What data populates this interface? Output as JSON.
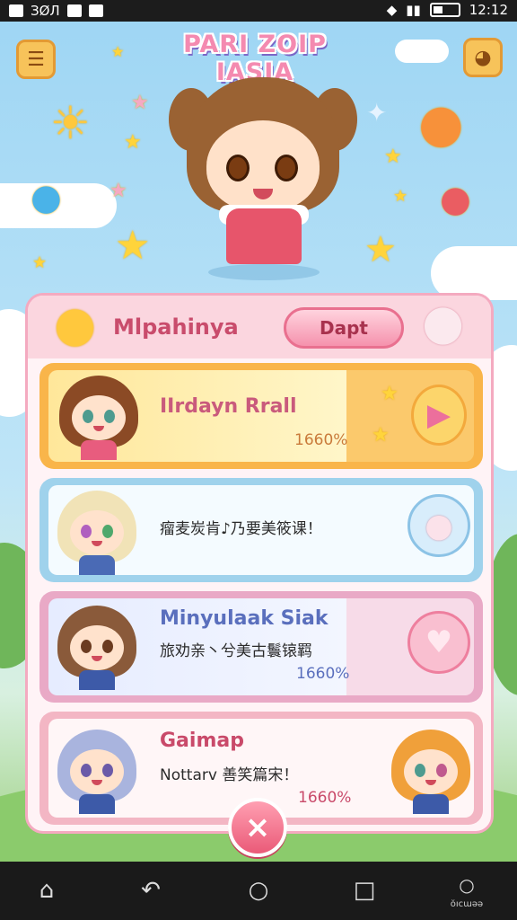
{
  "status_bar": {
    "left_text": "ЗØЛ",
    "time": "12:12",
    "icons": [
      "notification-icon",
      "photo-icon",
      "wifi-icon",
      "signal-icon",
      "battery-icon"
    ]
  },
  "header": {
    "title": "PARI ZOIP IASIA",
    "menu_icon": "menu-icon",
    "shop_icon": "shop-icon"
  },
  "panel": {
    "title": "Mlpahinya",
    "dapt_button": "Dapt"
  },
  "cards": [
    {
      "name": "IIrdayn Rrall",
      "text": "",
      "percent": "1660%",
      "action_icon": "play-icon",
      "avatar_hair": "#8b4a25",
      "accent": "#c95a7c"
    },
    {
      "name": "",
      "text": "瘤麦炭肯♪乃要美筱课！",
      "percent": "",
      "action_icon": "bunny-icon",
      "avatar_hair": "#f1e3b7",
      "accent": "#2b2b2b"
    },
    {
      "name": "Minyulaak Siak",
      "text": "旅劝亲丶兮美古鬟锿羁",
      "percent": "1660%",
      "action_icon": "heart-icon",
      "avatar_hair": "#8a5a3a",
      "accent": "#5a6fbd"
    },
    {
      "name": "Gaimap",
      "text": "Nottarv 善笑篇宋！",
      "percent": "1660%",
      "action_icon": "",
      "avatar_hair": "#a9b4de",
      "accent": "#c94a6a"
    }
  ],
  "close_button": "×",
  "nav": {
    "label": "ŏıcɯəə",
    "icons": [
      "home-icon",
      "back-icon",
      "circle-home-icon",
      "recents-icon",
      "assistant-icon"
    ]
  },
  "colors": {
    "sky": "#a9d8f2",
    "panel_border": "#f4aac0",
    "card1": "#ffe79a",
    "card2": "#eaf7ff",
    "card3": "#e6ecff",
    "card4": "#fff2f3",
    "pink_button": "#f592ad"
  }
}
